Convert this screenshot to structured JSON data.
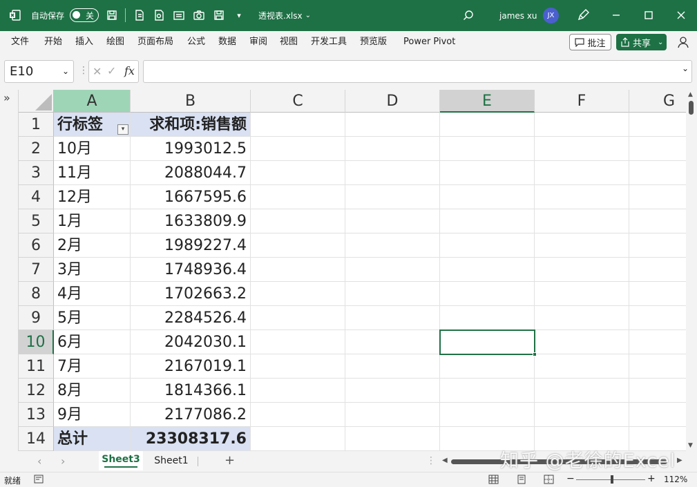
{
  "titlebar": {
    "autosave_label": "自动保存",
    "autosave_state": "关",
    "filename": "透视表.xlsx",
    "user_name": "james xu",
    "user_initials": "JX"
  },
  "menu": [
    "文件",
    "开始",
    "插入",
    "绘图",
    "页面布局",
    "公式",
    "数据",
    "审阅",
    "视图",
    "开发工具",
    "预览版",
    "Power Pivot"
  ],
  "comment_label": "批注",
  "share_label": "共享",
  "formula_bar": {
    "name_box": "E10",
    "fx": "fx",
    "formula": ""
  },
  "columns": [
    "A",
    "B",
    "C",
    "D",
    "E",
    "F",
    "G"
  ],
  "rows": [
    "1",
    "2",
    "3",
    "4",
    "5",
    "6",
    "7",
    "8",
    "9",
    "10",
    "11",
    "12",
    "13",
    "14"
  ],
  "pivot": {
    "header_label": "行标签",
    "header_value": "求和项:销售额",
    "items": [
      {
        "label": "10月",
        "value": "1993012.5"
      },
      {
        "label": "11月",
        "value": "2088044.7"
      },
      {
        "label": "12月",
        "value": "1667595.6"
      },
      {
        "label": "1月",
        "value": "1633809.9"
      },
      {
        "label": "2月",
        "value": "1989227.4"
      },
      {
        "label": "3月",
        "value": "1748936.4"
      },
      {
        "label": "4月",
        "value": "1702663.2"
      },
      {
        "label": "5月",
        "value": "2284526.4"
      },
      {
        "label": "6月",
        "value": "2042030.1"
      },
      {
        "label": "7月",
        "value": "2167019.1"
      },
      {
        "label": "8月",
        "value": "1814366.1"
      },
      {
        "label": "9月",
        "value": "2177086.2"
      }
    ],
    "total_label": "总计",
    "total_value": "23308317.6"
  },
  "sheets": [
    "Sheet3",
    "Sheet1"
  ],
  "active_sheet": "Sheet3",
  "status": {
    "ready": "就绪",
    "zoom": "112%"
  },
  "watermark": "知乎 @老徐的Excel",
  "colors": {
    "accent": "#1e7145",
    "pivot_header": "#d9e1f2"
  }
}
